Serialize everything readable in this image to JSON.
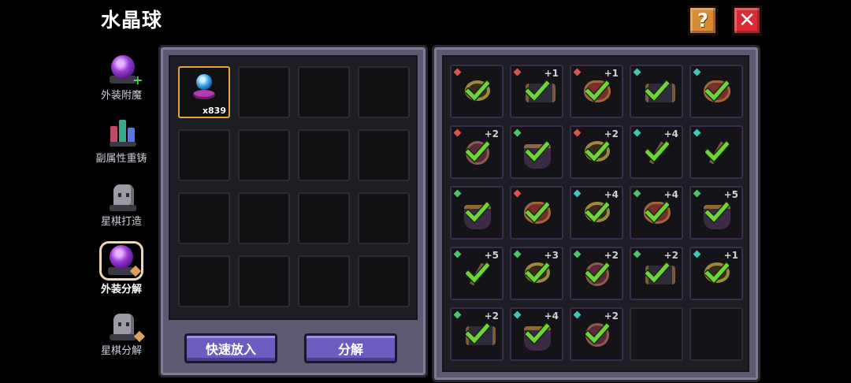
{
  "header": {
    "title": "水晶球",
    "help_icon": "?",
    "close_icon": "✕"
  },
  "sidebar": {
    "items": [
      {
        "label": "外装附魔",
        "icon": "crystal-ball-plus-icon",
        "active": false
      },
      {
        "label": "副属性重铸",
        "icon": "crystals-icon",
        "active": false
      },
      {
        "label": "星棋打造",
        "icon": "ghost-piece-icon",
        "active": false
      },
      {
        "label": "外装分解",
        "icon": "crystal-ball-hammer-icon",
        "active": true
      },
      {
        "label": "星棋分解",
        "icon": "ghost-piece-hammer-icon",
        "active": false
      }
    ]
  },
  "inventory": {
    "slots": [
      {
        "item": "crystal-ball",
        "count": "x839",
        "selected": true
      }
    ],
    "total_slots": 16
  },
  "actions": {
    "quick_add": "快速放入",
    "decompose": "分解"
  },
  "colors": {
    "gem_red": "#d9534f",
    "gem_teal": "#3ec6b8",
    "gem_green": "#4cc46a",
    "check": "#6fd43a"
  },
  "equipment": [
    {
      "kind": "amulet",
      "gem": "red",
      "level": ""
    },
    {
      "kind": "horns",
      "gem": "red",
      "level": "+1"
    },
    {
      "kind": "heart",
      "gem": "red",
      "level": "+1"
    },
    {
      "kind": "horns",
      "gem": "teal",
      "level": ""
    },
    {
      "kind": "heart",
      "gem": "teal",
      "level": ""
    },
    {
      "kind": "orb",
      "gem": "red",
      "level": "+2"
    },
    {
      "kind": "cauldron",
      "gem": "green",
      "level": ""
    },
    {
      "kind": "amulet",
      "gem": "red",
      "level": "+2"
    },
    {
      "kind": "wand",
      "gem": "teal",
      "level": "+4"
    },
    {
      "kind": "wand",
      "gem": "teal",
      "level": ""
    },
    {
      "kind": "cauldron",
      "gem": "green",
      "level": ""
    },
    {
      "kind": "heart",
      "gem": "red",
      "level": ""
    },
    {
      "kind": "amulet",
      "gem": "teal",
      "level": "+4"
    },
    {
      "kind": "heart",
      "gem": "green",
      "level": "+4"
    },
    {
      "kind": "cauldron",
      "gem": "green",
      "level": "+5"
    },
    {
      "kind": "wand",
      "gem": "green",
      "level": "+5"
    },
    {
      "kind": "amulet",
      "gem": "green",
      "level": "+3"
    },
    {
      "kind": "orb",
      "gem": "green",
      "level": "+2"
    },
    {
      "kind": "horns",
      "gem": "green",
      "level": "+2"
    },
    {
      "kind": "amulet",
      "gem": "teal",
      "level": "+1"
    },
    {
      "kind": "horns",
      "gem": "green",
      "level": "+2"
    },
    {
      "kind": "cauldron",
      "gem": "teal",
      "level": "+4"
    },
    {
      "kind": "orb",
      "gem": "teal",
      "level": "+2"
    },
    {
      "kind": "empty",
      "gem": "",
      "level": ""
    },
    {
      "kind": "empty",
      "gem": "",
      "level": ""
    }
  ]
}
